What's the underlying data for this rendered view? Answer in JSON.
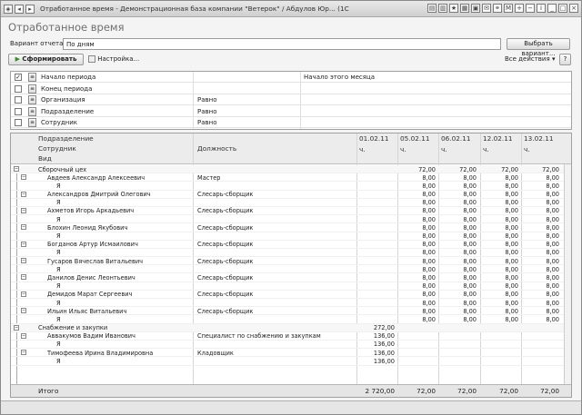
{
  "window": {
    "title": "Отработанное время - Демонстрационная база компании \"Ветерок\" / Абдулов Юр... (1С:Предприятие)"
  },
  "form": {
    "title": "Отработанное время",
    "variant_label": "Вариант отчета:",
    "variant_value": "По дням",
    "select_variant_button": "Выбрать вариант...",
    "generate_button": "Сформировать",
    "settings_button": "Настройка...",
    "all_actions": "Все действия",
    "help": "?"
  },
  "params": [
    {
      "checked": true,
      "name": "Начало периода",
      "comparison": "",
      "value": "Начало этого месяца"
    },
    {
      "checked": false,
      "name": "Конец периода",
      "comparison": "",
      "value": ""
    },
    {
      "checked": false,
      "name": "Организация",
      "comparison": "Равно",
      "value": ""
    },
    {
      "checked": false,
      "name": "Подразделение",
      "comparison": "Равно",
      "value": ""
    },
    {
      "checked": false,
      "name": "Сотрудник",
      "comparison": "Равно",
      "value": ""
    }
  ],
  "report": {
    "header": {
      "col_department": "Подразделение",
      "col_employee": "Сотрудник",
      "col_position": "Должность",
      "col_kind": "Вид",
      "dates": [
        "01.02.11",
        "05.02.11",
        "06.02.11",
        "12.02.11",
        "13.02.11"
      ],
      "units": [
        "ч.",
        "ч.",
        "ч.",
        "ч.",
        "ч."
      ]
    },
    "rows": [
      {
        "type": "group",
        "label": "Сборочный цех",
        "pos": "",
        "v": [
          "",
          "72,00",
          "72,00",
          "72,00",
          "72,00"
        ]
      },
      {
        "type": "emp",
        "label": "Авдеев Александр Алексеевич",
        "pos": "Мастер",
        "v": [
          "",
          "8,00",
          "8,00",
          "8,00",
          "8,00"
        ]
      },
      {
        "type": "kind",
        "label": "Я",
        "pos": "",
        "v": [
          "",
          "8,00",
          "8,00",
          "8,00",
          "8,00"
        ]
      },
      {
        "type": "emp",
        "label": "Александров Дмитрий Олегович",
        "pos": "Слесарь-сборщик",
        "v": [
          "",
          "8,00",
          "8,00",
          "8,00",
          "8,00"
        ]
      },
      {
        "type": "kind",
        "label": "Я",
        "pos": "",
        "v": [
          "",
          "8,00",
          "8,00",
          "8,00",
          "8,00"
        ]
      },
      {
        "type": "emp",
        "label": "Ахметов Игорь Аркадьевич",
        "pos": "Слесарь-сборщик",
        "v": [
          "",
          "8,00",
          "8,00",
          "8,00",
          "8,00"
        ]
      },
      {
        "type": "kind",
        "label": "Я",
        "pos": "",
        "v": [
          "",
          "8,00",
          "8,00",
          "8,00",
          "8,00"
        ]
      },
      {
        "type": "emp",
        "label": "Блохин Леонид Якубович",
        "pos": "Слесарь-сборщик",
        "v": [
          "",
          "8,00",
          "8,00",
          "8,00",
          "8,00"
        ]
      },
      {
        "type": "kind",
        "label": "Я",
        "pos": "",
        "v": [
          "",
          "8,00",
          "8,00",
          "8,00",
          "8,00"
        ]
      },
      {
        "type": "emp",
        "label": "Богданов Артур Исмаилович",
        "pos": "Слесарь-сборщик",
        "v": [
          "",
          "8,00",
          "8,00",
          "8,00",
          "8,00"
        ]
      },
      {
        "type": "kind",
        "label": "Я",
        "pos": "",
        "v": [
          "",
          "8,00",
          "8,00",
          "8,00",
          "8,00"
        ]
      },
      {
        "type": "emp",
        "label": "Гусаров Вячеслав Витальевич",
        "pos": "Слесарь-сборщик",
        "v": [
          "",
          "8,00",
          "8,00",
          "8,00",
          "8,00"
        ]
      },
      {
        "type": "kind",
        "label": "Я",
        "pos": "",
        "v": [
          "",
          "8,00",
          "8,00",
          "8,00",
          "8,00"
        ]
      },
      {
        "type": "emp",
        "label": "Данилов Денис Леонтьевич",
        "pos": "Слесарь-сборщик",
        "v": [
          "",
          "8,00",
          "8,00",
          "8,00",
          "8,00"
        ]
      },
      {
        "type": "kind",
        "label": "Я",
        "pos": "",
        "v": [
          "",
          "8,00",
          "8,00",
          "8,00",
          "8,00"
        ]
      },
      {
        "type": "emp",
        "label": "Демидов Марат Сергеевич",
        "pos": "Слесарь-сборщик",
        "v": [
          "",
          "8,00",
          "8,00",
          "8,00",
          "8,00"
        ]
      },
      {
        "type": "kind",
        "label": "Я",
        "pos": "",
        "v": [
          "",
          "8,00",
          "8,00",
          "8,00",
          "8,00"
        ]
      },
      {
        "type": "emp",
        "label": "Ильин Ильяс Витальевич",
        "pos": "Слесарь-сборщик",
        "v": [
          "",
          "8,00",
          "8,00",
          "8,00",
          "8,00"
        ]
      },
      {
        "type": "kind",
        "label": "Я",
        "pos": "",
        "v": [
          "",
          "8,00",
          "8,00",
          "8,00",
          "8,00"
        ]
      },
      {
        "type": "group",
        "label": "Снабжение и закупки",
        "pos": "",
        "v": [
          "272,00",
          "",
          "",
          "",
          ""
        ]
      },
      {
        "type": "emp",
        "label": "Аввакумов Вадим Иванович",
        "pos": "Специалист по снабжению и закупкам",
        "v": [
          "136,00",
          "",
          "",
          "",
          ""
        ]
      },
      {
        "type": "kind",
        "label": "Я",
        "pos": "",
        "v": [
          "136,00",
          "",
          "",
          "",
          ""
        ]
      },
      {
        "type": "emp",
        "label": "Тимофеева Ирина Владимировна",
        "pos": "Кладовщик",
        "v": [
          "136,00",
          "",
          "",
          "",
          ""
        ]
      },
      {
        "type": "kind",
        "label": "Я",
        "pos": "",
        "v": [
          "136,00",
          "",
          "",
          "",
          ""
        ]
      }
    ],
    "total": {
      "label": "Итого",
      "v": [
        "2 720,00",
        "72,00",
        "72,00",
        "72,00",
        "72,00"
      ]
    }
  }
}
